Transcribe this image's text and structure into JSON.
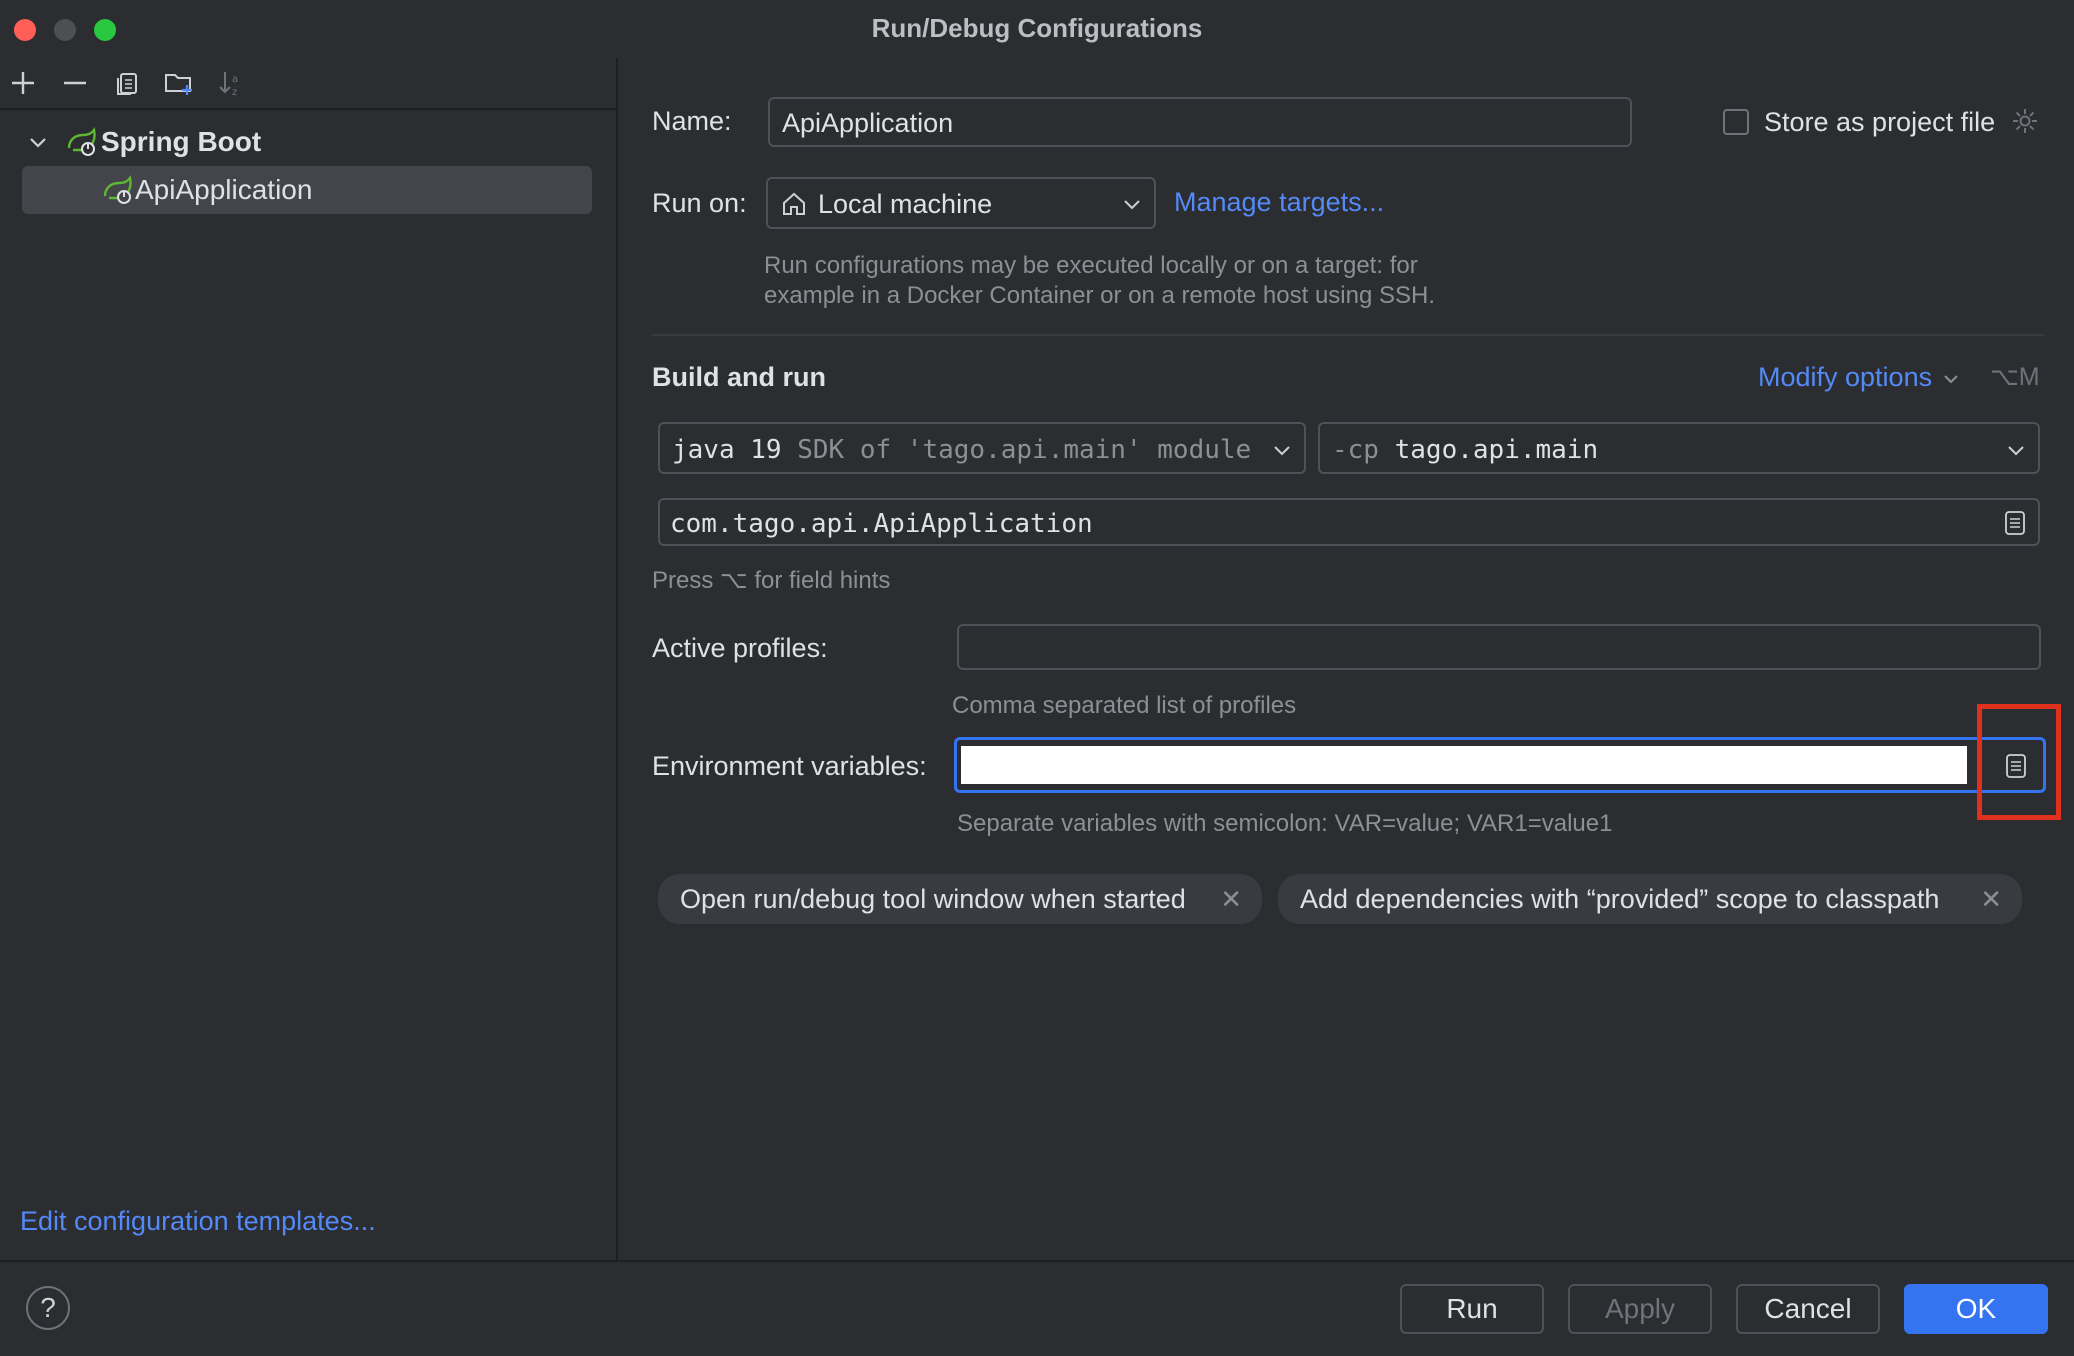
{
  "window": {
    "title": "Run/Debug Configurations"
  },
  "toolbar": {
    "add_icon": "plus-icon",
    "remove_icon": "minus-icon",
    "copy_icon": "copy-icon",
    "folder_icon": "new-folder-icon",
    "sort_icon": "sort-icon"
  },
  "tree": {
    "group_label": "Spring Boot",
    "items": [
      {
        "label": "ApiApplication"
      }
    ]
  },
  "left_footer": {
    "templates_link": "Edit configuration templates..."
  },
  "form": {
    "name_label": "Name:",
    "name_value": "ApiApplication",
    "store_label": "Store as project file",
    "store_checked": false,
    "run_on_label": "Run on:",
    "run_on_value": "Local machine",
    "manage_targets": "Manage targets...",
    "run_on_hint_line1": "Run configurations may be executed locally or on a target: for",
    "run_on_hint_line2": "example in a Docker Container or on a remote host using SSH.",
    "section_title": "Build and run",
    "modify_options": "Modify options",
    "modify_shortcut": "⌥M",
    "jre_main": "java 19",
    "jre_detail": "SDK of 'tago.api.main' module",
    "cp_prefix": "-cp",
    "cp_value": "tago.api.main",
    "main_class": "com.tago.api.ApiApplication",
    "field_hint": "Press ⌥ for field hints",
    "profiles_label": "Active profiles:",
    "profiles_value": "",
    "profiles_hint": "Comma separated list of profiles",
    "env_label": "Environment variables:",
    "env_value": "",
    "env_hint": "Separate variables with semicolon: VAR=value; VAR1=value1",
    "chips": [
      {
        "label": "Open run/debug tool window when started"
      },
      {
        "label": "Add dependencies with “provided” scope to classpath"
      }
    ]
  },
  "buttons": {
    "run": "Run",
    "apply": "Apply",
    "cancel": "Cancel",
    "ok": "OK"
  },
  "colors": {
    "accent": "#3574f0",
    "link": "#548af7",
    "highlight_box": "#e0301e"
  }
}
